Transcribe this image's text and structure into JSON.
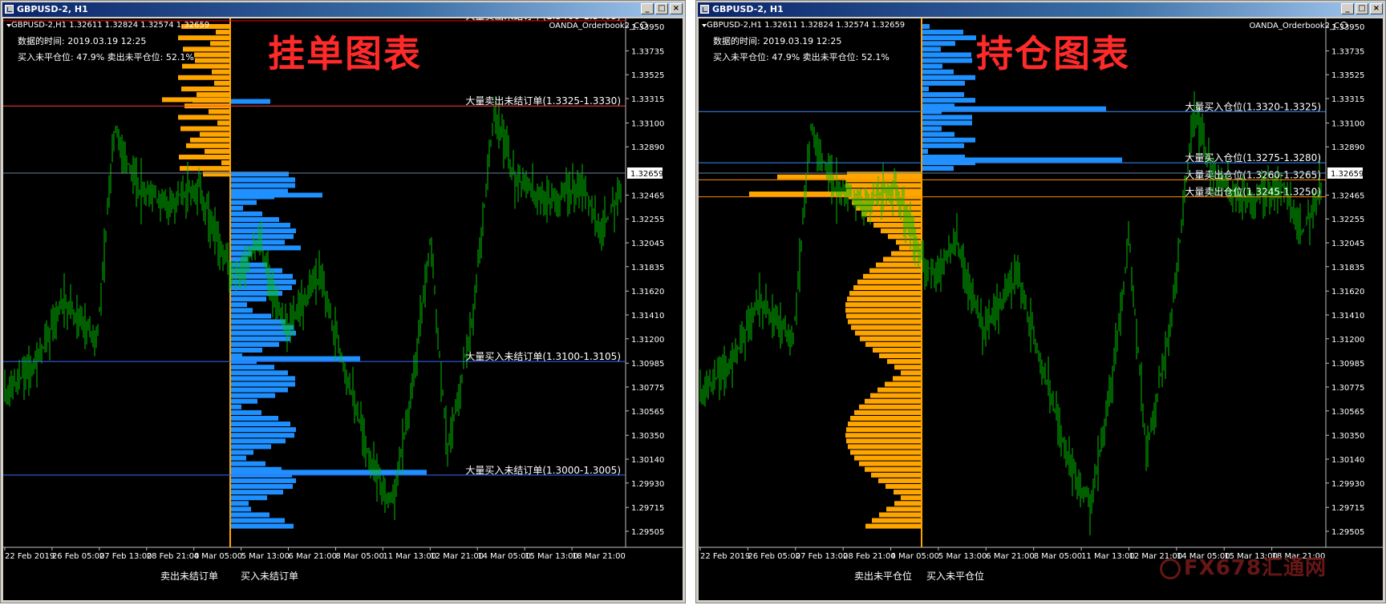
{
  "windows": [
    {
      "title": "GBPUSD-2, H1",
      "symbol_line": "GBPUSD-2,H1  1.32611 1.32824 1.32574 1.32659",
      "data_time": "数据的时间: 2019.03.19 12:25",
      "positions": "买入未平仓位: 47.9%  卖出未平仓位: 52.1%",
      "heading": "挂单图表",
      "indicator_name": "OANDA_Orderbook2_C",
      "left_label": "卖出未结订单",
      "right_label": "买入未结订单",
      "current_price": "1.32659",
      "annotations": [
        {
          "text": "大量卖出未结订单(1.3400-1.3405)",
          "price": 1.34,
          "line_color": "#ff0000"
        },
        {
          "text": "大量卖出未结订单(1.3325-1.3330)",
          "price": 1.3325,
          "line_color": "#ff4040"
        },
        {
          "text": "大量买入未结订单(1.3100-1.3105)",
          "price": 1.31,
          "line_color": "#3a6bff"
        },
        {
          "text": "大量买入未结订单(1.3000-1.3005)",
          "price": 1.3,
          "line_color": "#3a6bff"
        }
      ]
    },
    {
      "title": "GBPUSD-2, H1",
      "symbol_line": "GBPUSD-2,H1  1.32611 1.32824 1.32574 1.32659",
      "data_time": "数据的时间: 2019.03.19 12:25",
      "positions": "买入未平仓位: 47.9%  卖出未平仓位: 52.1%",
      "heading": "持仓图表",
      "indicator_name": "OANDA_Orderbook2_C",
      "left_label": "卖出未平仓位",
      "right_label": "买入未平仓位",
      "current_price": "1.32659",
      "annotations": [
        {
          "text": "大量买入仓位(1.3320-1.3325)",
          "price": 1.332,
          "line_color": "#3a8cff"
        },
        {
          "text": "大量买入仓位(1.3275-1.3280)",
          "price": 1.3275,
          "line_color": "#3a8cff"
        },
        {
          "text": "大量卖出仓位(1.3260-1.3265)",
          "price": 1.326,
          "line_color": "#ff8c00"
        },
        {
          "text": "大量卖出仓位(1.3245-1.3250)",
          "price": 1.3245,
          "line_color": "#ff8c00"
        }
      ]
    }
  ],
  "price_axis": [
    "1.33950",
    "1.33735",
    "1.33525",
    "1.33315",
    "1.33100",
    "1.32890",
    "1.32465",
    "1.32255",
    "1.32045",
    "1.31835",
    "1.31620",
    "1.31410",
    "1.31200",
    "1.30985",
    "1.30775",
    "1.30565",
    "1.30350",
    "1.30140",
    "1.29930",
    "1.29715",
    "1.29505"
  ],
  "time_axis": [
    "22 Feb 2019",
    "26 Feb 05:00",
    "27 Feb 13:00",
    "28 Feb 21:00",
    "4 Mar 05:00",
    "5 Mar 13:00",
    "6 Mar 21:00",
    "8 Mar 05:00",
    "11 Mar 13:00",
    "12 Mar 21:00",
    "14 Mar 05:00",
    "15 Mar 13:00",
    "18 Mar 21:00"
  ],
  "watermark": "FX678汇通网",
  "colors": {
    "sell": "#ffa500",
    "buy": "#1e90ff",
    "candles": "#00c000",
    "background": "#000000"
  }
}
